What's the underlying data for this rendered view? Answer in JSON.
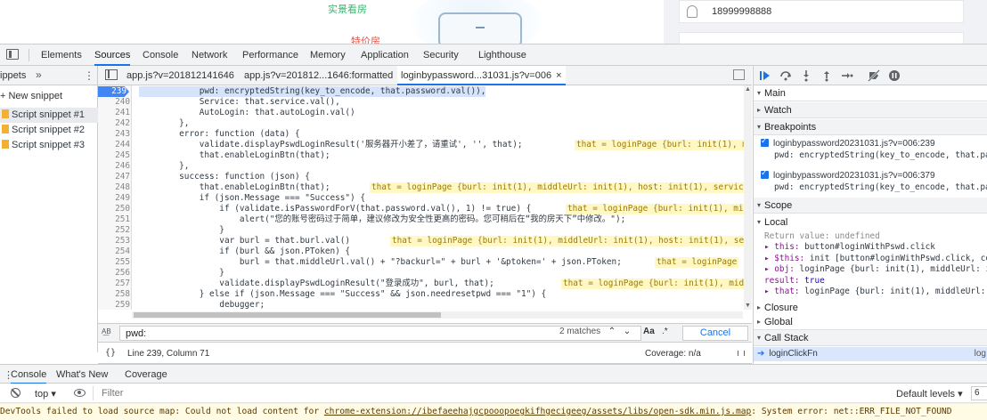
{
  "page": {
    "label_real": "实景看房",
    "label_special": "特价房",
    "phone": "18999998888"
  },
  "devtools": {
    "main_tabs": [
      "Elements",
      "Sources",
      "Console",
      "Network",
      "Performance",
      "Memory",
      "Application",
      "Security",
      "Lighthouse"
    ],
    "active_main_tab": "Sources",
    "navigator": {
      "header": "ippets",
      "more": "»",
      "kebab": "⋮",
      "new_snippet": "+ New snippet",
      "snippets": [
        "Script snippet #1",
        "Script snippet #2",
        "Script snippet #3"
      ]
    },
    "editor_tabs": [
      "app.js?v=201812141646",
      "app.js?v=201812...1646:formatted",
      "loginbypassword...31031.js?v=006"
    ],
    "active_editor_tab": 2,
    "close_glyph": "×",
    "code_lines": [
      {
        "n": "239",
        "code": "            pwd: encryptedString(key_to_encode, that.password.val()),",
        "bp": true,
        "inline": ""
      },
      {
        "n": "240",
        "code": "            Service: that.service.val(),",
        "bp": false,
        "inline": ""
      },
      {
        "n": "241",
        "code": "            AutoLogin: that.autoLogin.val()",
        "bp": false,
        "inline": ""
      },
      {
        "n": "242",
        "code": "        },",
        "bp": false,
        "inline": ""
      },
      {
        "n": "243",
        "code": "        error: function (data) {",
        "bp": false,
        "inline": ""
      },
      {
        "n": "244",
        "code": "            validate.displayPswdLoginResult('服务器开小差了，请重试', '', that);",
        "bp": false,
        "inline": "that = loginPage {burl: init(1), m"
      },
      {
        "n": "245",
        "code": "            that.enableLoginBtn(that);",
        "bp": false,
        "inline": ""
      },
      {
        "n": "246",
        "code": "        },",
        "bp": false,
        "inline": ""
      },
      {
        "n": "247",
        "code": "        success: function (json) {",
        "bp": false,
        "inline": ""
      },
      {
        "n": "248",
        "code": "            that.enableLoginBtn(that);",
        "bp": false,
        "inline": "that = loginPage {burl: init(1), middleUrl: init(1), host: init(1), service"
      },
      {
        "n": "249",
        "code": "            if (json.Message === \"Success\") {",
        "bp": false,
        "inline": ""
      },
      {
        "n": "250",
        "code": "                if (validate.isPasswordForV(that.password.val(), 1) != true) {",
        "bp": false,
        "inline": "that = loginPage {burl: init(1), mi"
      },
      {
        "n": "251",
        "code": "                    alert(\"您的账号密码过于简单，建议修改为安全性更高的密码。您可稍后在“我的房天下”中修改。\");",
        "bp": false,
        "inline": ""
      },
      {
        "n": "252",
        "code": "                }",
        "bp": false,
        "inline": ""
      },
      {
        "n": "253",
        "code": "                var burl = that.burl.val()",
        "bp": false,
        "inline": "that = loginPage {burl: init(1), middleUrl: init(1), host: init(1), ser"
      },
      {
        "n": "254",
        "code": "                if (burl && json.PToken) {",
        "bp": false,
        "inline": ""
      },
      {
        "n": "255",
        "code": "                    burl = that.middleUrl.val() + \"?backurl=\" + burl + '&ptoken=' + json.PToken;",
        "bp": false,
        "inline": "that = loginPage"
      },
      {
        "n": "256",
        "code": "                }",
        "bp": false,
        "inline": ""
      },
      {
        "n": "257",
        "code": "                validate.displayPswdLoginResult(\"登录成功\", burl, that);",
        "bp": false,
        "inline": "that = loginPage {burl: init(1), middleUr"
      },
      {
        "n": "258",
        "code": "            } else if (json.Message === \"Success\" && json.needresetpwd === \"1\") {",
        "bp": false,
        "inline": ""
      },
      {
        "n": "259",
        "code": "                debugger;",
        "bp": false,
        "inline": ""
      }
    ],
    "search": {
      "icon": "A͟B",
      "query": "pwd:",
      "matches": "2 matches",
      "aa": "Aa",
      "regex": ".*",
      "cancel": "Cancel"
    },
    "status": {
      "brackets": "{}",
      "position": "Line 239, Column 71",
      "coverage": "Coverage: n/a"
    },
    "debugger": {
      "sections": {
        "main": "Main",
        "watch": "Watch",
        "breakpoints": "Breakpoints",
        "scope": "Scope",
        "local": "Local",
        "closure": "Closure",
        "global": "Global",
        "call_stack": "Call Stack"
      },
      "breakpoints": [
        {
          "file": "loginbypassword20231031.js?v=006:239",
          "code": "pwd: encryptedString(key_to_encode, that.pa"
        },
        {
          "file": "loginbypassword20231031.js?v=006:379",
          "code": "pwd: encryptedString(key_to_encode, that.pa"
        }
      ],
      "scope_lines": [
        {
          "key": "Return value:",
          "val": "undefined",
          "style": "gray"
        },
        {
          "key": "▸ this:",
          "val": "button#loginWithPswd.click",
          "style": "obj"
        },
        {
          "key": "▸ $this:",
          "val": "init [button#loginWithPswd.click, con",
          "style": "obj"
        },
        {
          "key": "▸ obj:",
          "val": "loginPage {burl: init(1), middleUrl: in",
          "style": "obj"
        },
        {
          "key": "result:",
          "val": "true",
          "style": "bool"
        },
        {
          "key": "▸ that:",
          "val": "loginPage {burl: init(1), middleUrl: in",
          "style": "obj"
        }
      ],
      "call_stack": {
        "fn": "loginClickFn",
        "file": "log"
      }
    },
    "drawer_tabs": [
      "Console",
      "What's New",
      "Coverage"
    ],
    "console": {
      "context": "top ▾",
      "filter_placeholder": "Filter",
      "levels": "Default levels ▾",
      "badge": "6",
      "warning_prefix": "DevTools failed to load source map: Could not load content for ",
      "warning_link": "chrome-extension://ibefaeehajgcpooopoegkifhgecigeeg/assets/libs/open-sdk.min.js.map",
      "warning_suffix": ": System error: net::ERR_FILE_NOT_FOUND",
      "prompt": "›"
    }
  }
}
